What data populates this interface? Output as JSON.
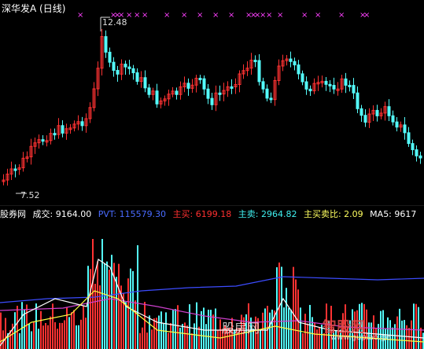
{
  "header": {
    "title": "深华发A (日线)"
  },
  "price_panel": {
    "high_label": "12.48",
    "low_label": "7.52",
    "colors": {
      "up": "#ff3232",
      "down": "#54fcfc",
      "signal": "#ff40ff"
    }
  },
  "indicator_bar": {
    "site": "股券网",
    "volume": "成交: 9164.00",
    "pvt": "PVT: 115579.30",
    "buy": "主买: 6199.18",
    "sell": "主卖: 2964.82",
    "ratio": "主买卖比: 2.09",
    "ma5": "MA5: 9617"
  },
  "watermark": {
    "text1": "股房网",
    "text2": "智股网",
    "text3": "www.gupiao.ge"
  }
}
